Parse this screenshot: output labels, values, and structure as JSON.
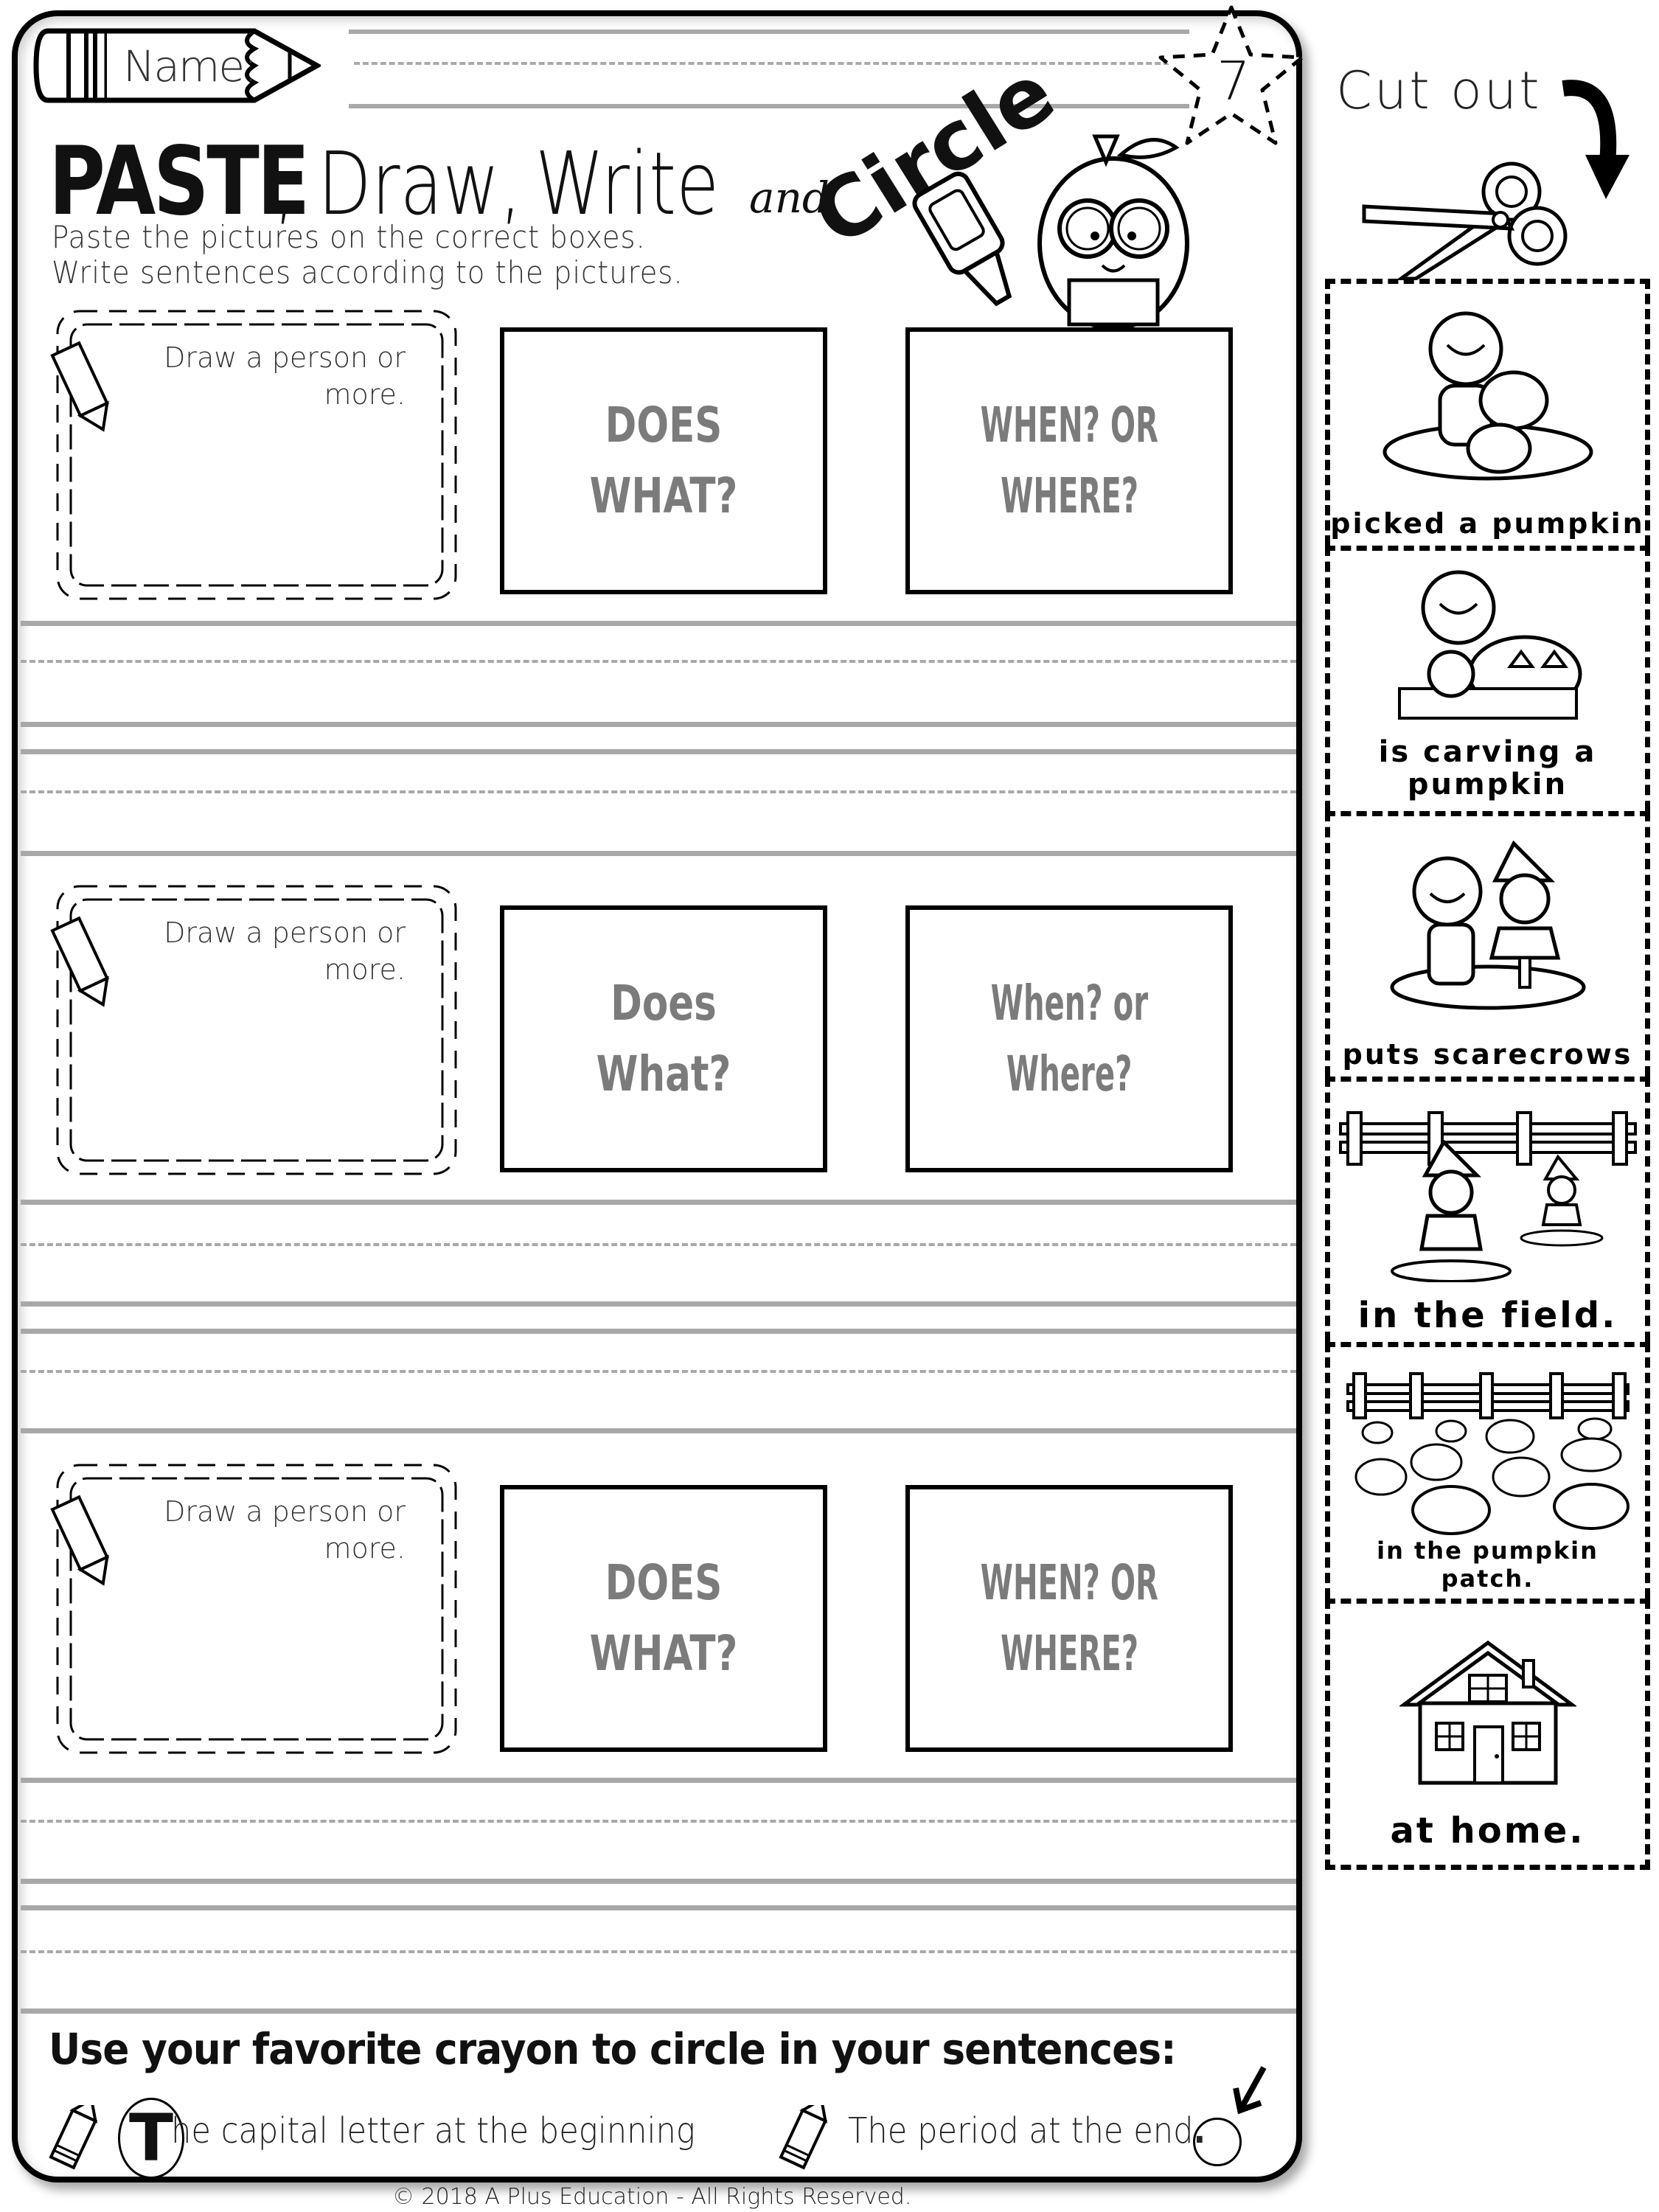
{
  "header": {
    "name_label": "Name:",
    "page_number": "7"
  },
  "title": {
    "paste": "PASTE",
    "draw": ", Draw,",
    "write": "Write",
    "and": "and",
    "circle": "Circle"
  },
  "instructions": {
    "line1": "Paste the pictures on the correct boxes.",
    "line2": "Write sentences according to the pictures."
  },
  "rows": [
    {
      "draw_prompt_line1": "Draw a person or",
      "draw_prompt_line2": "more.",
      "box1": "DOES WHAT?",
      "box2_line1": "WHEN? OR",
      "box2_line2": "WHERE?"
    },
    {
      "draw_prompt_line1": "Draw a person or",
      "draw_prompt_line2": "more.",
      "box1": "Does What?",
      "box2_line1": "When? or",
      "box2_line2": "Where?"
    },
    {
      "draw_prompt_line1": "Draw a person or",
      "draw_prompt_line2": "more.",
      "box1": "DOES WHAT?",
      "box2_line1": "WHEN? OR",
      "box2_line2": "WHERE?"
    }
  ],
  "cutout": {
    "label": "Cut out",
    "cards": [
      {
        "text": "picked a pumpkin",
        "icon": "boy-with-pumpkins-icon"
      },
      {
        "text_line1": "is carving a",
        "text_line2": "pumpkin",
        "icon": "boy-carving-pumpkin-icon"
      },
      {
        "text": "puts scarecrows",
        "icon": "girl-with-scarecrow-icon"
      },
      {
        "text": "in the field.",
        "icon": "scarecrows-field-icon"
      },
      {
        "text": "in the pumpkin patch.",
        "icon": "pumpkin-patch-icon"
      },
      {
        "text": "at home.",
        "icon": "house-icon"
      }
    ]
  },
  "footer": {
    "instruction": "Use your favorite crayon to circle in your sentences:",
    "tip1_letter": "T",
    "tip1_rest": "he capital letter at the beginning",
    "tip2_text": "The period at the end",
    "tip2_period": ".",
    "copyright": "© 2018 A Plus Education - All Rights Reserved."
  }
}
